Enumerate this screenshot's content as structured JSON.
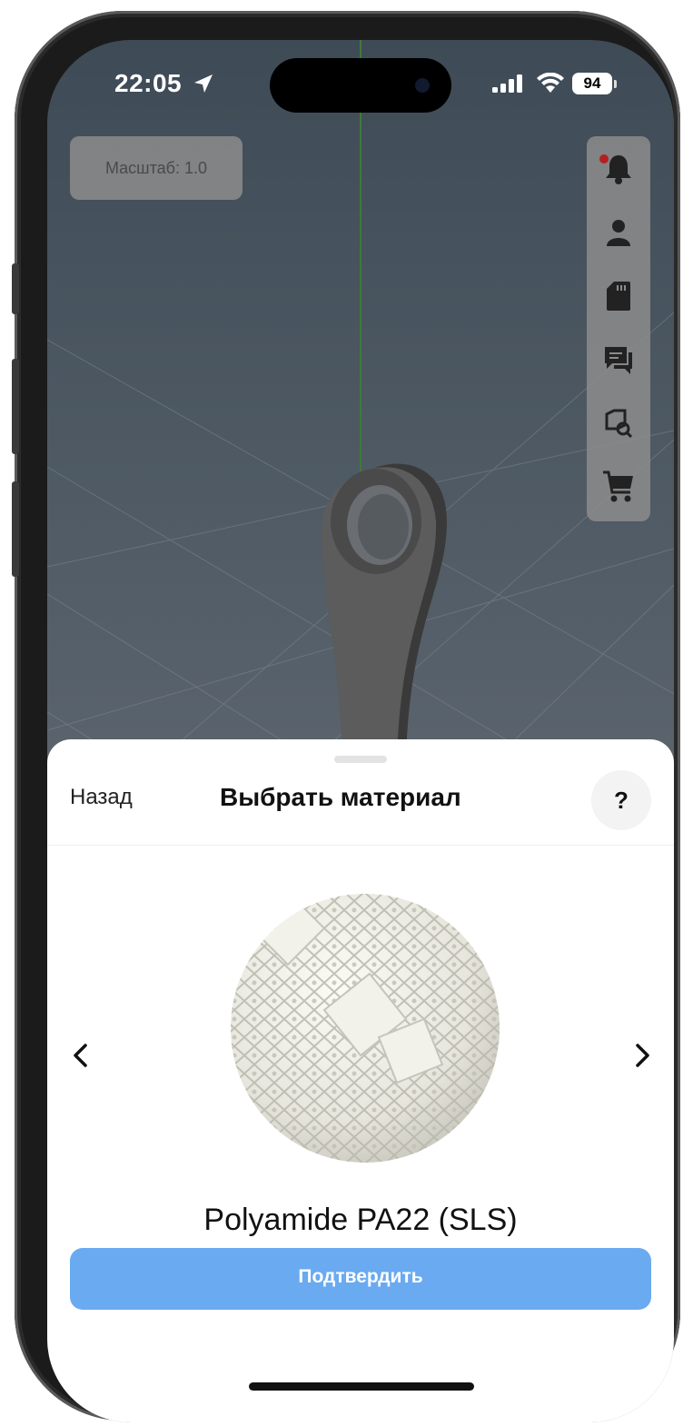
{
  "status_bar": {
    "time": "22:05",
    "battery": "94"
  },
  "viewport": {
    "scale_label": "Масштаб: 1.0",
    "toolbar": [
      {
        "icon": "bell-icon",
        "has_notification": true
      },
      {
        "icon": "user-icon"
      },
      {
        "icon": "sd-card-icon"
      },
      {
        "icon": "chat-icon"
      },
      {
        "icon": "box-search-icon"
      },
      {
        "icon": "cart-icon"
      }
    ]
  },
  "sheet": {
    "back_label": "Назад",
    "title": "Выбрать материал",
    "help_label": "?",
    "material_name": "Polyamide PA22 (SLS)",
    "confirm_label": "Подтвердить"
  },
  "colors": {
    "accent": "#6aaaf0",
    "notification": "#b3201e"
  }
}
